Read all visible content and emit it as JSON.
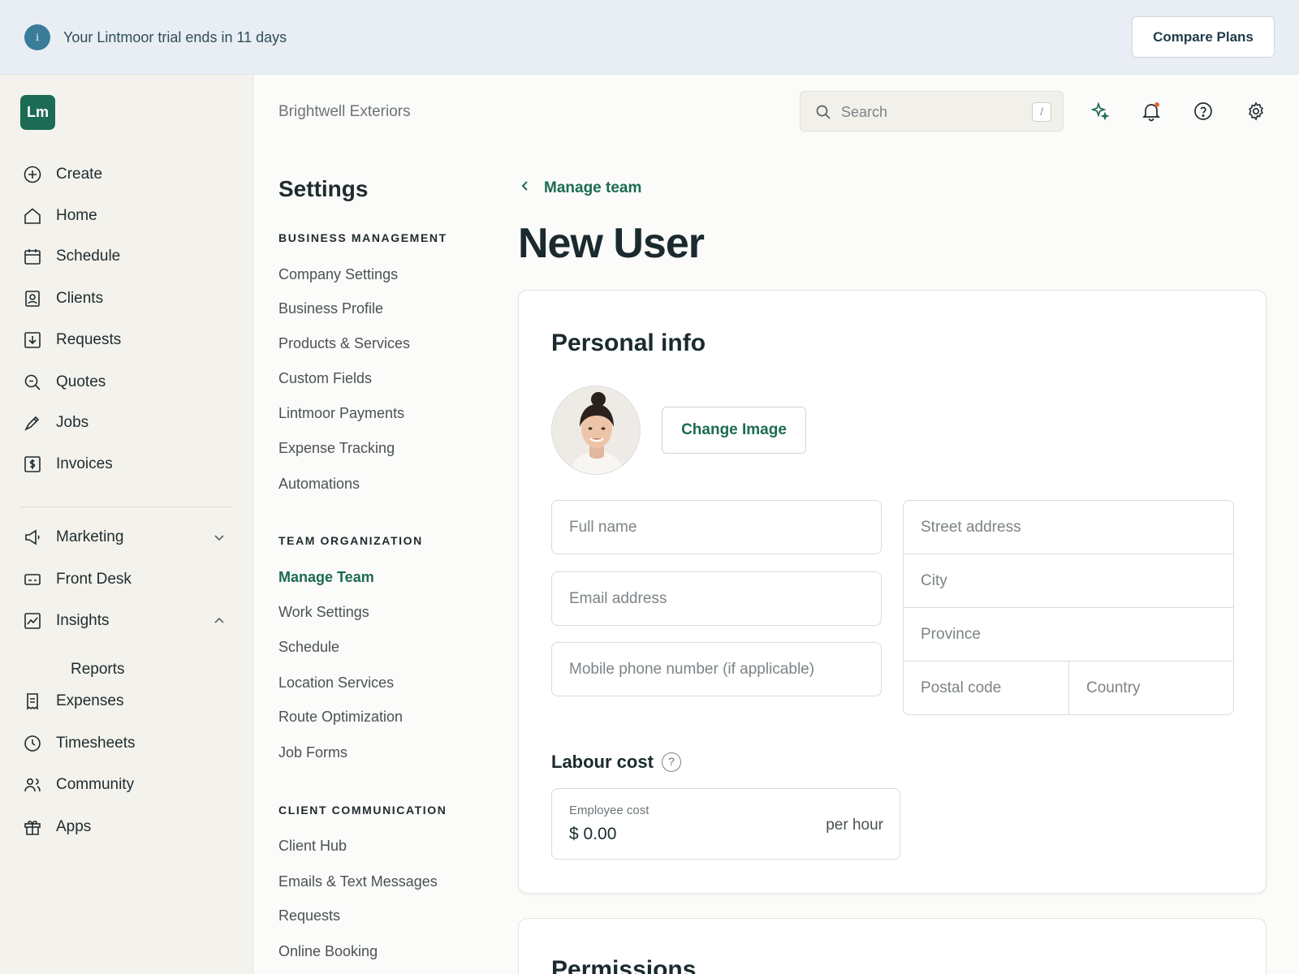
{
  "banner": {
    "text": "Your Lintmoor trial ends in 11 days",
    "info_glyph": "i",
    "compare_label": "Compare Plans"
  },
  "sidebar": {
    "logo": "Lm",
    "items": [
      {
        "label": "Create",
        "icon": "plus-circle-icon"
      },
      {
        "label": "Home",
        "icon": "home-icon"
      },
      {
        "label": "Schedule",
        "icon": "calendar-icon"
      },
      {
        "label": "Clients",
        "icon": "contact-card-icon"
      },
      {
        "label": "Requests",
        "icon": "inbox-download-icon"
      },
      {
        "label": "Quotes",
        "icon": "magnifier-quote-icon"
      },
      {
        "label": "Jobs",
        "icon": "hammer-icon"
      },
      {
        "label": "Invoices",
        "icon": "dollar-doc-icon"
      },
      {
        "label": "Marketing",
        "icon": "megaphone-icon"
      },
      {
        "label": "Front Desk",
        "icon": "front-desk-icon"
      },
      {
        "label": "Insights",
        "icon": "chart-icon"
      },
      {
        "label": "Reports"
      },
      {
        "label": "Expenses",
        "icon": "receipt-icon"
      },
      {
        "label": "Timesheets",
        "icon": "clock-icon"
      },
      {
        "label": "Community",
        "icon": "people-icon"
      },
      {
        "label": "Apps",
        "icon": "gift-icon"
      }
    ]
  },
  "topbar": {
    "company": "Brightwell Exteriors",
    "search_placeholder": "Search",
    "search_shortcut": "/"
  },
  "settings": {
    "title": "Settings",
    "sections": [
      {
        "heading": "BUSINESS MANAGEMENT",
        "links": [
          "Company Settings",
          "Business Profile",
          "Products & Services",
          "Custom Fields",
          "Lintmoor Payments",
          "Expense Tracking",
          "Automations"
        ]
      },
      {
        "heading": "TEAM ORGANIZATION",
        "links": [
          "Manage Team",
          "Work Settings",
          "Schedule",
          "Location Services",
          "Route Optimization",
          "Job Forms"
        ]
      },
      {
        "heading": "CLIENT COMMUNICATION",
        "links": [
          "Client Hub",
          "Emails & Text Messages",
          "Requests",
          "Online Booking"
        ]
      }
    ],
    "active_link": "Manage Team"
  },
  "main": {
    "back_label": "Manage team",
    "title": "New User",
    "personal": {
      "title": "Personal info",
      "change_image_label": "Change Image",
      "full_name_placeholder": "Full name",
      "email_placeholder": "Email address",
      "phone_placeholder": "Mobile phone number (if applicable)",
      "street_placeholder": "Street address",
      "city_placeholder": "City",
      "province_placeholder": "Province",
      "postal_placeholder": "Postal code",
      "country_placeholder": "Country"
    },
    "labour": {
      "title": "Labour cost",
      "help_glyph": "?",
      "cost_label": "Employee cost",
      "cost_value": "$ 0.00",
      "cost_unit": "per hour"
    },
    "permissions_title": "Permissions"
  },
  "colors": {
    "accent": "#1c6b54",
    "banner_bg": "#e8eef3",
    "sidebar_bg": "#f3f2ec",
    "notification_dot": "#e0673a"
  }
}
